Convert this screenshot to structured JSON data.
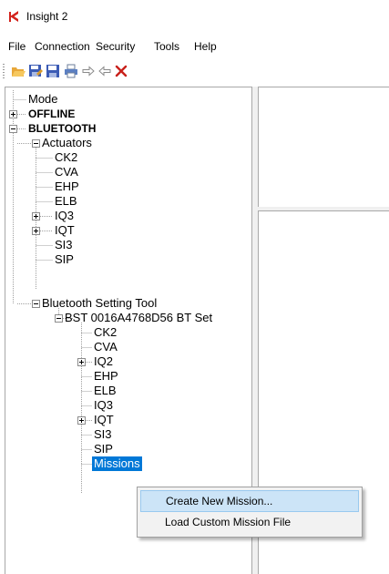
{
  "window": {
    "title": "Insight 2",
    "brand_color": "#d3221c"
  },
  "menubar": {
    "items": [
      "File",
      "Connection",
      "Security",
      "Tools",
      "Help"
    ]
  },
  "toolbar": {
    "buttons": [
      "open-folder-icon",
      "save-as-icon",
      "save-icon",
      "print-icon",
      "arrow-right-icon",
      "arrow-left-icon",
      "delete-icon"
    ]
  },
  "tree": {
    "mode": "Mode",
    "offline": "OFFLINE",
    "bluetooth": "BLUETOOTH",
    "actuators": {
      "label": "Actuators",
      "children": [
        "CK2",
        "CVA",
        "EHP",
        "ELB",
        "IQ3",
        "IQT",
        "SI3",
        "SIP"
      ]
    },
    "bst": {
      "label": "Bluetooth Setting Tool",
      "device": {
        "label": "BST 0016A4768D56 BT Set",
        "children": [
          "CK2",
          "CVA",
          "IQ2",
          "EHP",
          "ELB",
          "IQ3",
          "IQT",
          "SI3",
          "SIP",
          "Missions"
        ]
      }
    },
    "selection_color": "#0078d7"
  },
  "context_menu": {
    "items": [
      "Create New Mission...",
      "Load Custom Mission File"
    ]
  }
}
